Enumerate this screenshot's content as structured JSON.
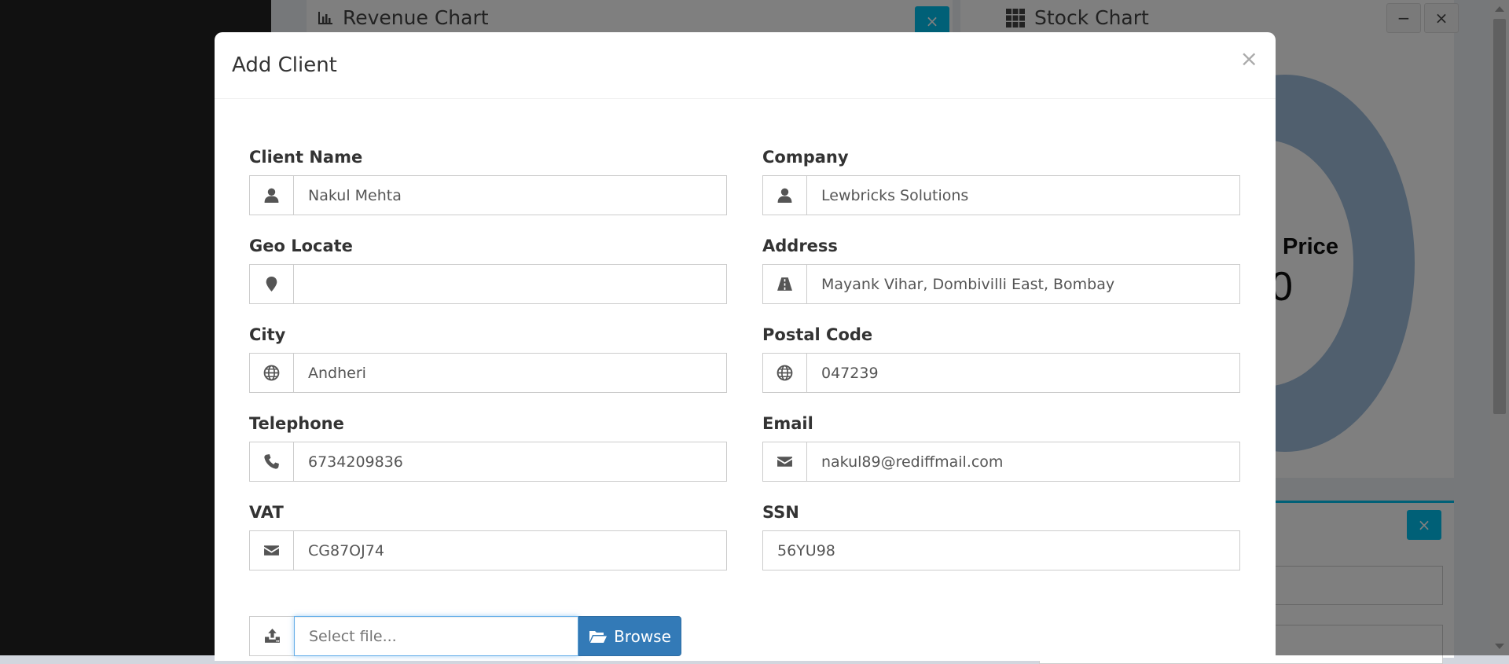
{
  "background": {
    "revenue_chart": {
      "title": "Revenue Chart",
      "close_icon": "×"
    },
    "stock_chart": {
      "title": "Stock Chart",
      "minimize_icon": "−",
      "close_icon": "×"
    },
    "donut": {
      "label": "Price",
      "value": "0"
    },
    "lower_box": {
      "close_icon": "×"
    }
  },
  "modal": {
    "title": "Add Client",
    "close_icon": "×",
    "fields": {
      "client_name": {
        "label": "Client Name",
        "value": "Nakul Mehta",
        "icon": "user-icon"
      },
      "company": {
        "label": "Company",
        "value": "Lewbricks Solutions",
        "icon": "user-icon"
      },
      "geo_locate": {
        "label": "Geo Locate",
        "value": "",
        "icon": "map-marker-icon"
      },
      "address": {
        "label": "Address",
        "value": "Mayank Vihar, Dombivilli East, Bombay",
        "icon": "road-icon"
      },
      "city": {
        "label": "City",
        "value": "Andheri",
        "icon": "globe-icon"
      },
      "postal_code": {
        "label": "Postal Code",
        "value": "047239",
        "icon": "globe-icon"
      },
      "telephone": {
        "label": "Telephone",
        "value": "6734209836",
        "icon": "phone-icon"
      },
      "email": {
        "label": "Email",
        "value": "nakul89@rediffmail.com",
        "icon": "envelope-icon"
      },
      "vat": {
        "label": "VAT",
        "value": "CG87OJ74",
        "icon": "envelope-icon"
      },
      "ssn": {
        "label": "SSN",
        "value": "56YU98"
      }
    },
    "file_upload": {
      "placeholder": "Select file...",
      "browse_label": "Browse",
      "icon": "upload-icon"
    }
  },
  "colors": {
    "primary": "#337ab7",
    "info": "#00c0ef",
    "donut": "#a0bfdc"
  }
}
